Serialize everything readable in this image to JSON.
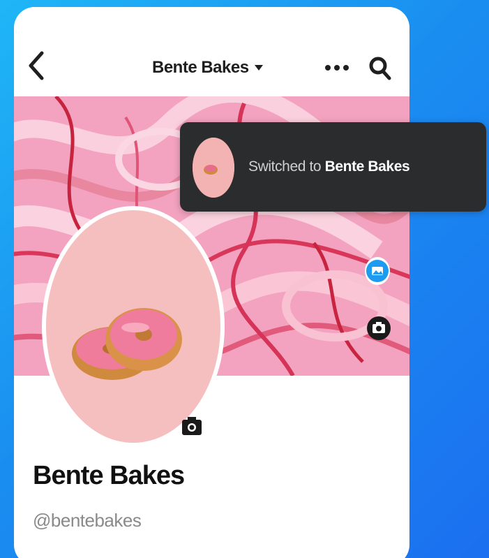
{
  "header": {
    "account_name": "Bente Bakes",
    "back_icon": "chevron-left-icon",
    "dropdown_icon": "caret-down-icon",
    "more_icon": "ellipsis-icon",
    "search_icon": "search-icon"
  },
  "toast": {
    "prefix": "Switched to ",
    "account": "Bente Bakes"
  },
  "profile": {
    "name": "Bente Bakes",
    "handle": "@bentebakes"
  },
  "colors": {
    "background_gradient_start": "#1fb6f6",
    "background_gradient_end": "#1b6ff0",
    "toast_bg": "#2b2c2d",
    "cover_pink": "#f4a6c0",
    "avatar_bg": "#f5bfbf",
    "accent_blue": "#1d9bf0"
  }
}
